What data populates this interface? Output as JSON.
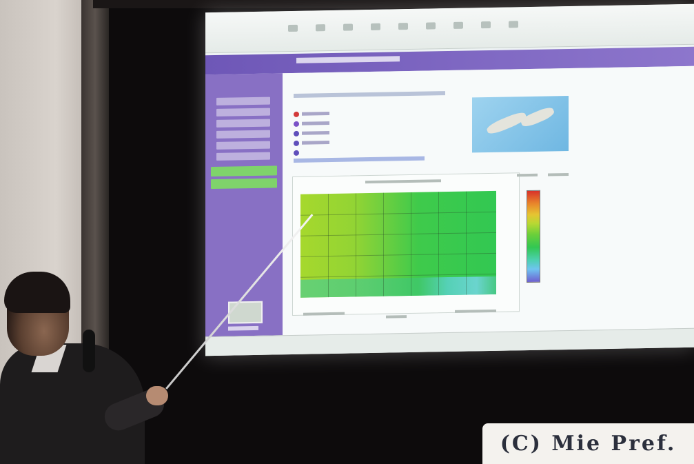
{
  "watermark": {
    "text": "(C) Mie Pref."
  },
  "colors": {
    "screen_purple": "#8870c4",
    "heatmap_green": "#3fca4b",
    "heatmap_yellow_green": "#a6d82d"
  }
}
